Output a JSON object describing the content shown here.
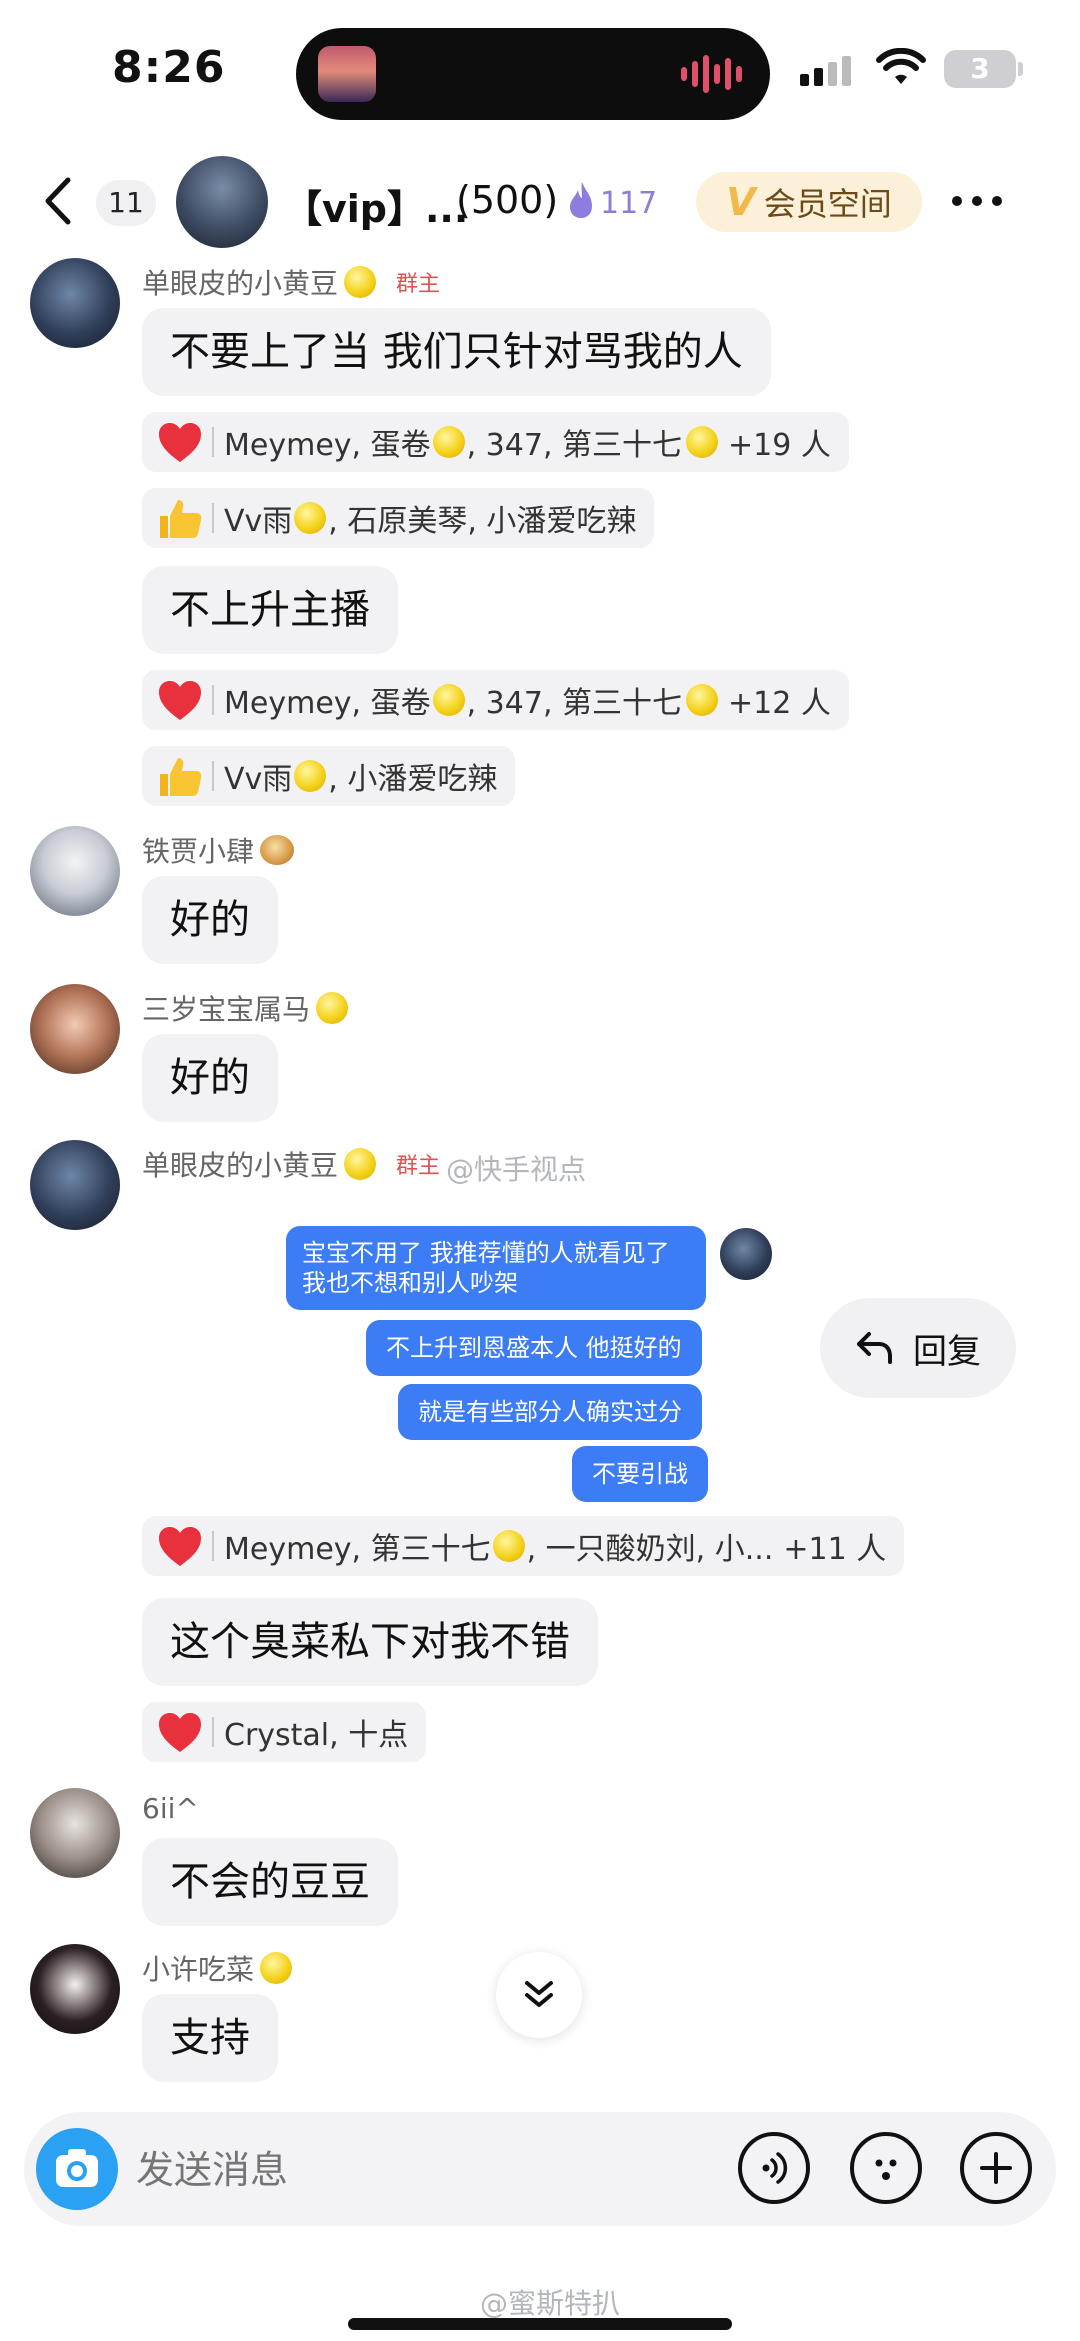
{
  "status_bar": {
    "time": "8:26",
    "battery": "3"
  },
  "header": {
    "back_count": "11",
    "group_name": "【vip】...",
    "member_count": "(500)",
    "fire_count": "117",
    "vip_space_label": "会员空间"
  },
  "messages": [
    {
      "sender": "单眼皮的小黄豆",
      "role": "群主",
      "text": "不要上了当 我们只针对骂我的人",
      "reactions": [
        {
          "icon": "heart-icon",
          "names": "Meymey, 蛋卷",
          "more_names": ", 347, 第三十七",
          "extra": "+19 人"
        },
        {
          "icon": "thumbs-up-icon",
          "names": "Vv雨",
          "more_names": ", 石原美琴, 小潘爱吃辣",
          "extra": ""
        }
      ]
    },
    {
      "text": "不上升主播",
      "reactions": [
        {
          "icon": "heart-icon",
          "names": "Meymey, 蛋卷",
          "more_names": ", 347, 第三十七",
          "extra": "+12 人"
        },
        {
          "icon": "thumbs-up-icon",
          "names": "Vv雨",
          "more_names": ", 小潘爱吃辣",
          "extra": ""
        }
      ]
    },
    {
      "sender": "铁贾小肆",
      "text": "好的"
    },
    {
      "sender": "三岁宝宝属马",
      "text": "好的"
    },
    {
      "sender": "单眼皮的小黄豆",
      "role": "群主",
      "watermark": "@快手视点",
      "screenshot": {
        "lines": [
          "宝宝不用了 我推荐懂的人就看见了",
          "我也不想和别人吵架"
        ],
        "bubbles": [
          "不上升到恩盛本人 他挺好的",
          "就是有些部分人确实过分",
          "不要引战"
        ],
        "reply_label": "回复"
      },
      "reactions": [
        {
          "icon": "heart-icon",
          "names": "Meymey, 第三十七",
          "more_names": ", 一只酸奶刘, 小...",
          "extra": "+11 人"
        }
      ]
    },
    {
      "text": "这个臭菜私下对我不错",
      "reactions": [
        {
          "icon": "heart-icon",
          "names": "Crystal, 十点"
        }
      ]
    },
    {
      "sender": "6ii^",
      "text": "不会的豆豆"
    },
    {
      "sender": "小许吃菜",
      "text": "支持"
    }
  ],
  "input": {
    "placeholder": "发送消息"
  },
  "footer_watermark": "@蜜斯特扒"
}
